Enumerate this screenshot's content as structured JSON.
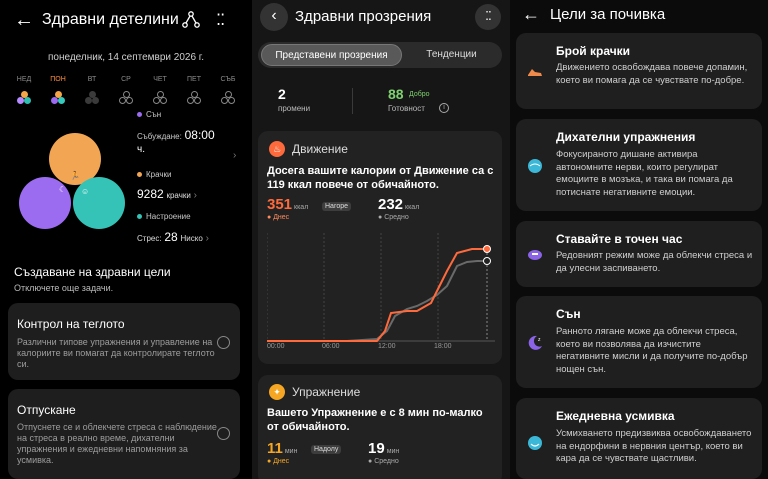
{
  "panel1": {
    "title": "Здравни детелини",
    "date": "понеделник, 14 септември 2026 г.",
    "days": [
      {
        "label": "НЕД",
        "active": false
      },
      {
        "label": "ПОН",
        "active": true
      },
      {
        "label": "ВТ",
        "active": false
      },
      {
        "label": "СР",
        "active": false
      },
      {
        "label": "ЧЕТ",
        "active": false
      },
      {
        "label": "ПЕТ",
        "active": false
      },
      {
        "label": "СЪБ",
        "active": false
      }
    ],
    "stats": {
      "sleep_label": "Сън",
      "wake_label": "Събуждане:",
      "wake_value": "08:00",
      "wake_unit": "ч.",
      "steps_label": "Крачки",
      "steps_value": "9282",
      "steps_unit": "крачки",
      "mood_label": "Настроение",
      "stress_label": "Стрес:",
      "stress_value": "28",
      "stress_level": "Ниско"
    },
    "goals_title": "Създаване на здравни цели",
    "goals_sub": "Отключете още задачи.",
    "cards": [
      {
        "title": "Контрол на теглото",
        "desc": "Различни типове упражнения и управление на калориите ви помагат да контролирате теглото си."
      },
      {
        "title": "Отпускане",
        "desc": "Отпуснете се и облекчете стреса с наблюдение на стреса в реално време, дихателни упражнения и ежедневни напомняния за усмивка."
      }
    ]
  },
  "panel2": {
    "title": "Здравни прозрения",
    "tab_insights": "Представени прозрения",
    "tab_trends": "Тенденции",
    "changes_value": "2",
    "changes_label": "промени",
    "readiness_value": "88",
    "readiness_badge": "Добро",
    "readiness_label": "Готовност",
    "movement": {
      "title": "Движение",
      "text": "Досега вашите калории от Движение са с 119 ккал повече от обичайното.",
      "today_value": "351",
      "today_unit": "ккал",
      "today_tag": "Нагоре",
      "today_label": "Днес",
      "avg_value": "232",
      "avg_unit": "ккал",
      "avg_label": "Средно",
      "x_labels": [
        "00:00",
        "06:00",
        "12:00",
        "18:00"
      ]
    },
    "exercise": {
      "title": "Упражнение",
      "text": "Вашето Упражнение е с 8 мин по-малко от обичайното.",
      "today_value": "11",
      "today_unit": "мин",
      "today_tag": "Надолу",
      "today_label": "Днес",
      "avg_value": "19",
      "avg_unit": "мин",
      "avg_label": "Средно"
    }
  },
  "panel3": {
    "title": "Цели за почивка",
    "cards": [
      {
        "title": "Брой крачки",
        "desc": "Движението освобождава повече допамин, което ви помага да се чувствате по-добре."
      },
      {
        "title": "Дихателни упражнения",
        "desc": "Фокусираното дишане активира автономните нерви, които регулират емоциите в мозъка, и така ви помага да потиснате негативните емоции."
      },
      {
        "title": "Ставайте в точен час",
        "desc": "Редовният режим може да облекчи стреса и да улесни заспиването."
      },
      {
        "title": "Сън",
        "desc": "Ранното лягане може да облекчи стреса, което ви позволява да изчистите негативните мисли и да получите по-добър нощен сън."
      },
      {
        "title": "Ежедневна усмивка",
        "desc": "Усмихването предизвиква освобождаването на ендорфини в нервния център, което ви кара да се чувствате щастливи."
      }
    ]
  },
  "colors": {
    "orange": "#f2a654",
    "purple": "#9c6cf0",
    "teal": "#34c3b6",
    "accent_red": "#ff6a3d",
    "green": "#7fd06f"
  }
}
